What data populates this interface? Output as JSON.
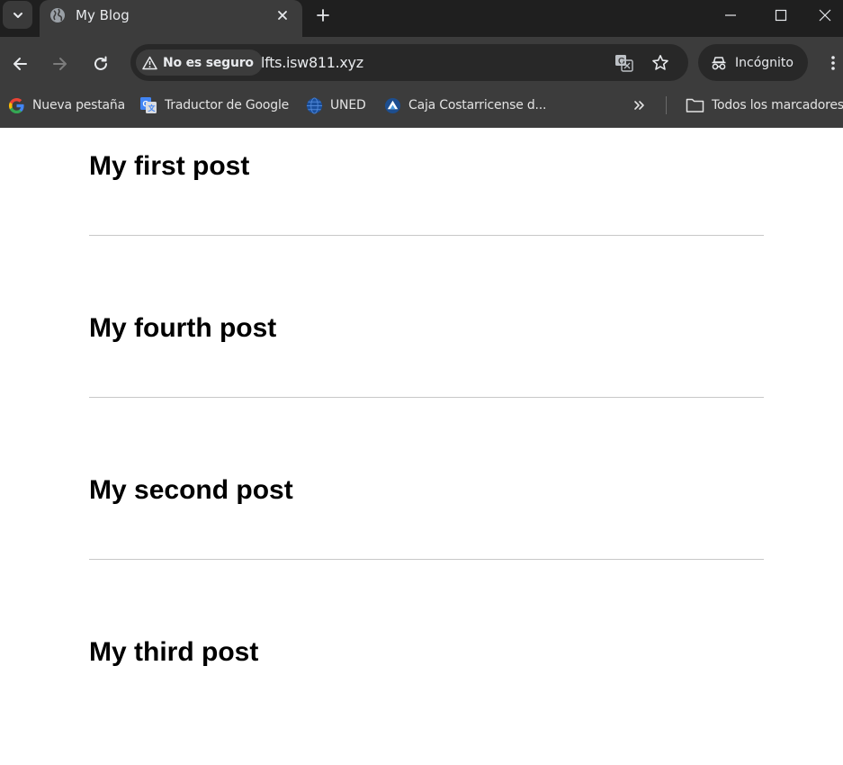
{
  "tab": {
    "title": "My Blog"
  },
  "omnibox": {
    "security_label": "No es seguro",
    "url": "lfts.isw811.xyz"
  },
  "profile": {
    "label": "Incógnito"
  },
  "bookmarks": {
    "items": [
      {
        "label": "Nueva pestaña",
        "icon": "google-icon"
      },
      {
        "label": "Traductor de Google",
        "icon": "google-translate-icon"
      },
      {
        "label": "UNED",
        "icon": "uned-globe-icon"
      },
      {
        "label": "Caja Costarricense d...",
        "icon": "ccss-icon"
      }
    ],
    "all_bookmarks_label": "Todos los marcadores"
  },
  "posts": [
    {
      "title": "My first post"
    },
    {
      "title": "My fourth post"
    },
    {
      "title": "My second post"
    },
    {
      "title": "My third post"
    }
  ],
  "colors": {
    "tabstrip": "#1f1f1f",
    "toolbar": "#3c3c3c",
    "omnibox": "#282828",
    "page_bg": "#ffffff",
    "divider": "#c8c8c8",
    "text_light": "#e8eaed"
  }
}
